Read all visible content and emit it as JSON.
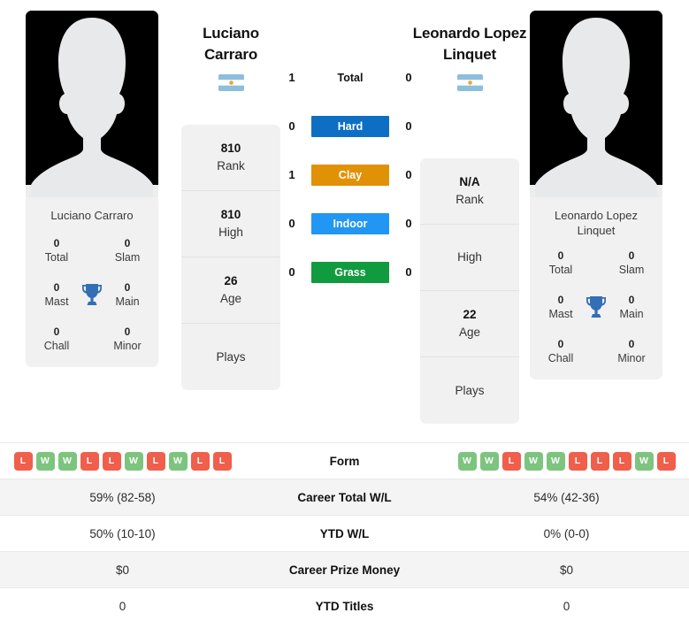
{
  "players": {
    "left": {
      "name": "Luciano Carraro",
      "name_lines": [
        "Luciano",
        "Carraro"
      ],
      "card_name": "Luciano Carraro",
      "flag": "argentina-flag",
      "titles": [
        {
          "value": "0",
          "label": "Total"
        },
        {
          "value": "0",
          "label": "Slam"
        },
        {
          "value": "0",
          "label": "Mast"
        },
        {
          "value": "0",
          "label": "Main"
        },
        {
          "value": "0",
          "label": "Chall"
        },
        {
          "value": "0",
          "label": "Minor"
        }
      ],
      "info": [
        {
          "value": "810",
          "label": "Rank"
        },
        {
          "value": "810",
          "label": "High"
        },
        {
          "value": "26",
          "label": "Age"
        },
        {
          "value": "",
          "label": "Plays"
        }
      ],
      "form": [
        "L",
        "W",
        "W",
        "L",
        "L",
        "W",
        "L",
        "W",
        "L",
        "L"
      ],
      "career_total_wl": "59% (82-58)",
      "ytd_wl": "50% (10-10)",
      "career_prize_money": "$0",
      "ytd_titles": "0",
      "h2h": {
        "total": "1",
        "hard": "0",
        "clay": "1",
        "indoor": "0",
        "grass": "0"
      }
    },
    "right": {
      "name": "Leonardo Lopez Linquet",
      "name_lines": [
        "Leonardo Lopez",
        "Linquet"
      ],
      "card_name_lines": [
        "Leonardo Lopez",
        "Linquet"
      ],
      "flag": "argentina-flag",
      "titles": [
        {
          "value": "0",
          "label": "Total"
        },
        {
          "value": "0",
          "label": "Slam"
        },
        {
          "value": "0",
          "label": "Mast"
        },
        {
          "value": "0",
          "label": "Main"
        },
        {
          "value": "0",
          "label": "Chall"
        },
        {
          "value": "0",
          "label": "Minor"
        }
      ],
      "info": [
        {
          "value": "N/A",
          "label": "Rank"
        },
        {
          "value": "",
          "label": "High"
        },
        {
          "value": "22",
          "label": "Age"
        },
        {
          "value": "",
          "label": "Plays"
        }
      ],
      "form": [
        "W",
        "W",
        "L",
        "W",
        "W",
        "L",
        "L",
        "L",
        "W",
        "L"
      ],
      "career_total_wl": "54% (42-36)",
      "ytd_wl": "0% (0-0)",
      "career_prize_money": "$0",
      "ytd_titles": "0",
      "h2h": {
        "total": "0",
        "hard": "0",
        "clay": "0",
        "indoor": "0",
        "grass": "0"
      }
    }
  },
  "surfaces": [
    {
      "key": "total",
      "label": "Total",
      "left": "1",
      "right": "0",
      "color": "none",
      "plain": true
    },
    {
      "key": "hard",
      "label": "Hard",
      "left": "0",
      "right": "0",
      "color": "#0d6fc4",
      "plain": false
    },
    {
      "key": "clay",
      "label": "Clay",
      "left": "1",
      "right": "0",
      "color": "#e19106",
      "plain": false
    },
    {
      "key": "indoor",
      "label": "Indoor",
      "left": "0",
      "right": "0",
      "color": "#2196f3",
      "plain": false
    },
    {
      "key": "grass",
      "label": "Grass",
      "left": "0",
      "right": "0",
      "color": "#0f9b3e",
      "plain": false
    }
  ],
  "table": {
    "rows": [
      {
        "key": "form",
        "label": "Form",
        "type": "form"
      },
      {
        "key": "ctwl",
        "label": "Career Total W/L",
        "type": "text",
        "left": "59% (82-58)",
        "right": "54% (42-36)"
      },
      {
        "key": "ytdwl",
        "label": "YTD W/L",
        "type": "text",
        "left": "50% (10-10)",
        "right": "0% (0-0)"
      },
      {
        "key": "cpm",
        "label": "Career Prize Money",
        "type": "text",
        "left": "$0",
        "right": "$0"
      },
      {
        "key": "ytdt",
        "label": "YTD Titles",
        "type": "text",
        "left": "0",
        "right": "0"
      }
    ]
  },
  "colors": {
    "hard": "#0d6fc4",
    "clay": "#e19106",
    "indoor": "#2196f3",
    "grass": "#0f9b3e",
    "win_badge": "#7dc47f",
    "loss_badge": "#ef5f4c",
    "card_bg": "#f1f1f1",
    "row_alt_bg": "#f4f4f4"
  }
}
